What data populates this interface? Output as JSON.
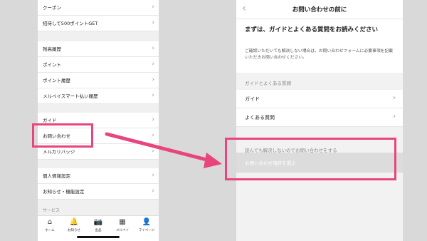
{
  "left_screen": {
    "rows_top": [
      {
        "label": "クーポン"
      },
      {
        "label": "招待して500ポイントGET"
      }
    ],
    "rows_history": [
      {
        "label": "残高履歴"
      },
      {
        "label": "ポイント"
      },
      {
        "label": "ポイント履歴"
      },
      {
        "label": "メルペイスマート払い履歴"
      }
    ],
    "rows_help": [
      {
        "label": "ガイド"
      },
      {
        "label": "お問い合わせ"
      },
      {
        "label": "メルカリバッジ"
      }
    ],
    "rows_settings": [
      {
        "label": "個人情報設定"
      },
      {
        "label": "お知らせ・機能設定"
      }
    ],
    "section_service": "サービス",
    "tabs": [
      {
        "label": "ホーム",
        "icon": "home-icon",
        "glyph": "⌂"
      },
      {
        "label": "お知らせ",
        "icon": "bell-icon",
        "glyph": "🔔"
      },
      {
        "label": "出品",
        "icon": "camera-icon",
        "glyph": "📷"
      },
      {
        "label": "メルペイ",
        "icon": "qr-icon",
        "glyph": "▦"
      },
      {
        "label": "マイページ",
        "icon": "person-icon",
        "glyph": "👤"
      }
    ]
  },
  "right_screen": {
    "nav_title": "お問い合わせの前に",
    "heading": "まずは、ガイドとよくある質問をお読みください",
    "description": "ご確認いただいても解決しない場合は、お問い合わせフォームに必要事項を記載いただきお問い合わせください。",
    "section_label": "ガイドとよくある質問",
    "rows": [
      {
        "label": "ガイド"
      },
      {
        "label": "よくある質問"
      }
    ],
    "unresolved_label": "読んでも解決しないのでお問い合わせをする",
    "select_placeholder": "お問い合わせ項目を選ぶ"
  },
  "chevron": "›",
  "back_glyph": "‹",
  "colors": {
    "highlight": "#e8457f",
    "background": "#d9d9d9"
  }
}
